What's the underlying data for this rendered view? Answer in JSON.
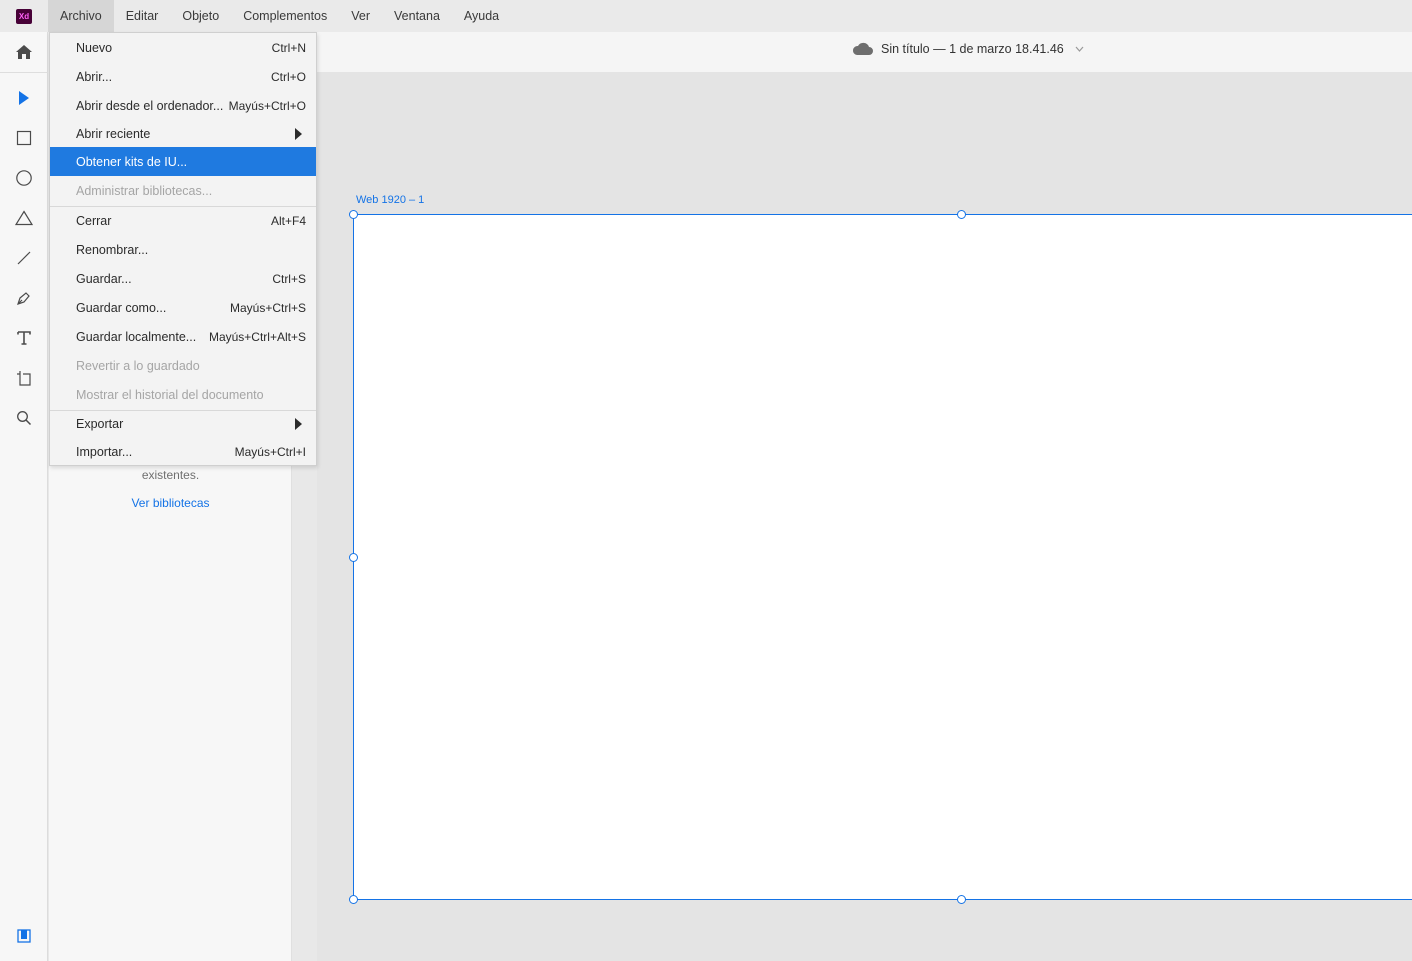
{
  "app": {
    "logo_text": "Xd",
    "logo_color": "#470137",
    "accent": "#1473e6"
  },
  "menubar": {
    "items": [
      "Archivo",
      "Editar",
      "Objeto",
      "Complementos",
      "Ver",
      "Ventana",
      "Ayuda"
    ],
    "active": "Archivo"
  },
  "document": {
    "title": "Sin título — 1 de marzo 18.41.46",
    "cloud_icon": "cloud-icon"
  },
  "toolbar": {
    "tools": [
      "home-icon",
      "select-icon",
      "rectangle-icon",
      "ellipse-icon",
      "polygon-icon",
      "line-icon",
      "pen-icon",
      "text-icon",
      "artboard-icon",
      "zoom-icon",
      "libraries-icon"
    ]
  },
  "file_menu": {
    "items": [
      {
        "label": "Nuevo",
        "shortcut": "Ctrl+N"
      },
      {
        "label": "Abrir...",
        "shortcut": "Ctrl+O"
      },
      {
        "label": "Abrir desde el ordenador...",
        "shortcut": "Mayús+Ctrl+O"
      },
      {
        "label": "Abrir reciente",
        "shortcut": "",
        "submenu": true
      },
      {
        "label": "Obtener kits de IU...",
        "shortcut": "",
        "highlighted": true
      },
      {
        "label": "Administrar bibliotecas...",
        "shortcut": "",
        "disabled": true
      },
      {
        "label": "Cerrar",
        "shortcut": "Alt+F4"
      },
      {
        "label": "Renombrar...",
        "shortcut": ""
      },
      {
        "label": "Guardar...",
        "shortcut": "Ctrl+S"
      },
      {
        "label": "Guardar como...",
        "shortcut": "Mayús+Ctrl+S"
      },
      {
        "label": "Guardar localmente...",
        "shortcut": "Mayús+Ctrl+Alt+S"
      },
      {
        "label": "Revertir a lo guardado",
        "shortcut": "",
        "disabled": true
      },
      {
        "label": "Mostrar el historial del documento",
        "shortcut": "",
        "disabled": true
      },
      {
        "label": "Exportar",
        "shortcut": "",
        "submenu": true
      },
      {
        "label": "Importar...",
        "shortcut": "Mayús+Ctrl+I"
      }
    ]
  },
  "libraries_panel": {
    "text_partial": "existentes.",
    "link": "Ver bibliotecas"
  },
  "artboard": {
    "label": "Web 1920 – 1"
  }
}
